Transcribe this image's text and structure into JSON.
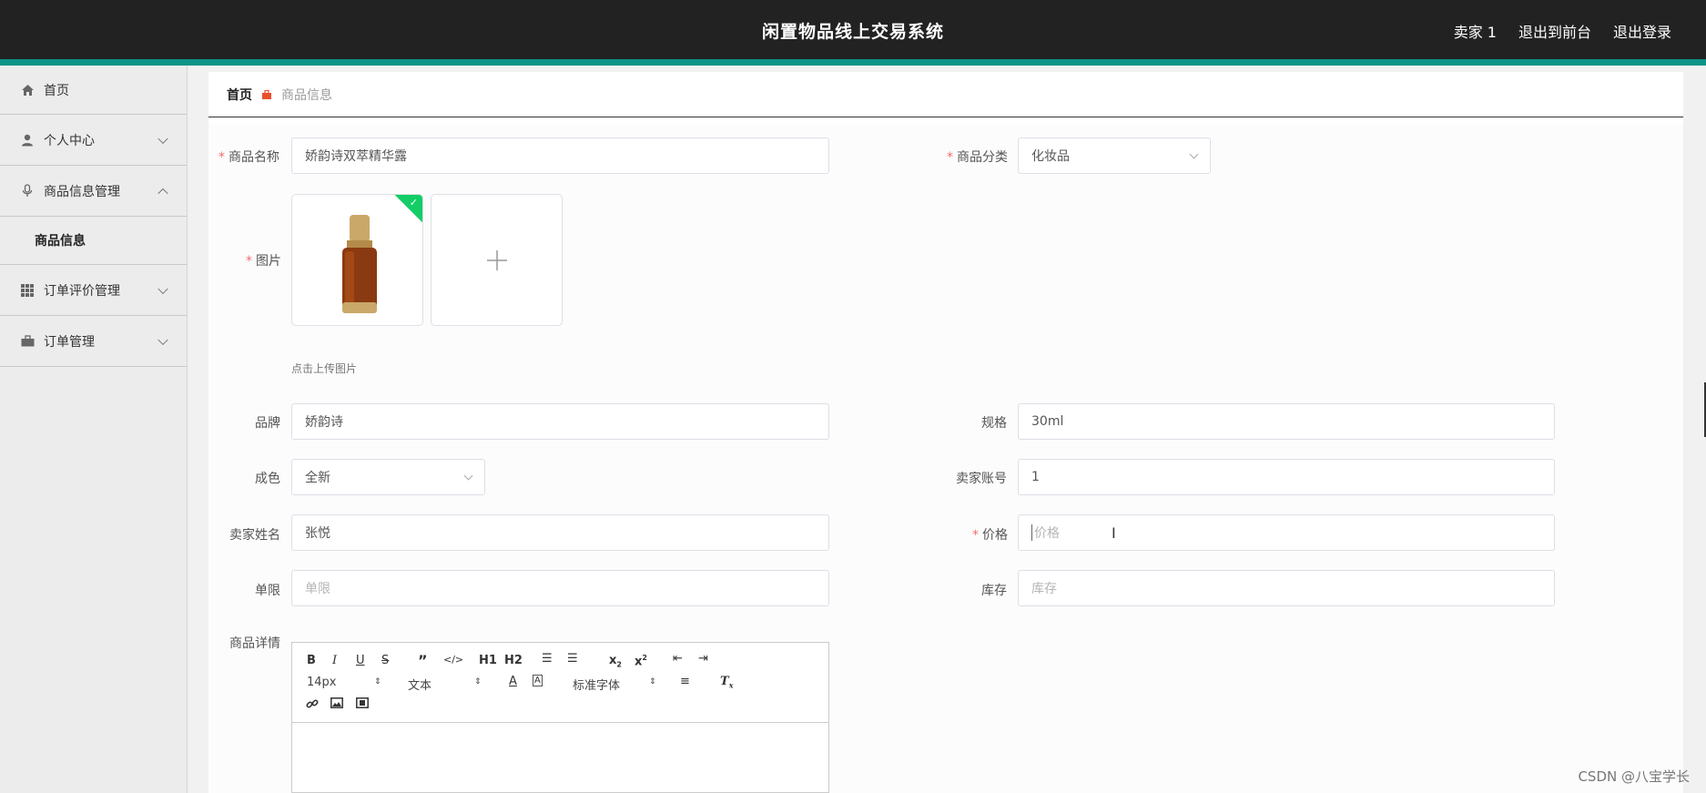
{
  "header": {
    "title": "闲置物品线上交易系统",
    "user_label": "卖家 1",
    "front_link": "退出到前台",
    "logout_link": "退出登录"
  },
  "sidebar": {
    "items": [
      {
        "label": "首页",
        "icon": "home-icon"
      },
      {
        "label": "个人中心",
        "icon": "user-icon"
      },
      {
        "label": "商品信息管理",
        "icon": "microphone-icon",
        "expanded": true
      },
      {
        "label": "商品信息"
      },
      {
        "label": "订单评价管理",
        "icon": "grid-icon"
      },
      {
        "label": "订单管理",
        "icon": "briefcase-icon"
      }
    ]
  },
  "breadcrumb": {
    "home": "首页",
    "current": "商品信息"
  },
  "form": {
    "name_label": "商品名称",
    "name_value": "娇韵诗双萃精华露",
    "category_label": "商品分类",
    "category_value": "化妆品",
    "image_label": "图片",
    "upload_hint": "点击上传图片",
    "brand_label": "品牌",
    "brand_value": "娇韵诗",
    "spec_label": "规格",
    "spec_value": "30ml",
    "condition_label": "成色",
    "condition_value": "全新",
    "seller_account_label": "卖家账号",
    "seller_account_value": "1",
    "seller_name_label": "卖家姓名",
    "seller_name_value": "张悦",
    "price_label": "价格",
    "price_placeholder": "价格",
    "limit_label": "单限",
    "limit_placeholder": "单限",
    "stock_label": "库存",
    "stock_placeholder": "库存",
    "detail_label": "商品详情"
  },
  "editor": {
    "font_size": "14px",
    "text_type": "文本",
    "font_family": "标准字体",
    "h1": "H1",
    "h2": "H2"
  },
  "watermark": "CSDN @八宝学长",
  "colors": {
    "accent": "#0e9488",
    "header_bg": "#222222",
    "required": "#f56c6c",
    "success": "#13ce66"
  }
}
